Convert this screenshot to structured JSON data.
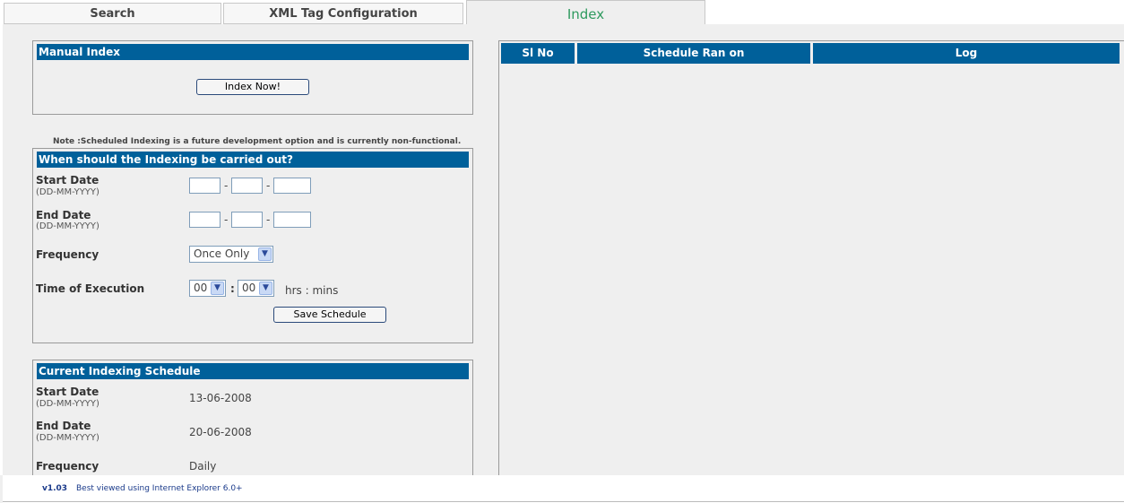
{
  "tabs": [
    {
      "label": "Search"
    },
    {
      "label": "XML Tag Configuration"
    },
    {
      "label": "Index"
    }
  ],
  "manual_index": {
    "title": "Manual Index",
    "button": "Index Now!"
  },
  "note": "Note :Scheduled Indexing is a future development option and is currently non-functional.",
  "schedule_form": {
    "title": "When should the Indexing be carried out?",
    "start_date_label": "Start Date",
    "start_date_hint": "(DD-MM-YYYY)",
    "end_date_label": "End Date",
    "end_date_hint": "(DD-MM-YYYY)",
    "frequency_label": "Frequency",
    "frequency_value": "Once Only",
    "time_label": "Time of Execution",
    "hours_value": "00",
    "minutes_value": "00",
    "time_separator": ":",
    "date_separator": "-",
    "time_unit": "hrs : mins",
    "save_button": "Save Schedule"
  },
  "current_schedule": {
    "title": "Current Indexing Schedule",
    "start_date_label": "Start Date",
    "start_date_hint": "(DD-MM-YYYY)",
    "start_date_value": "13-06-2008",
    "end_date_label": "End Date",
    "end_date_hint": "(DD-MM-YYYY)",
    "end_date_value": "20-06-2008",
    "frequency_label": "Frequency",
    "frequency_value": "Daily"
  },
  "log_table": {
    "columns": [
      "Sl No",
      "Schedule Ran on",
      "Log"
    ],
    "rows": []
  },
  "footer": {
    "version": "v1.03",
    "hint": "Best viewed using Internet Explorer 6.0+"
  },
  "colors": {
    "header_blue": "#00609a",
    "active_tab_green": "#2e9a5e",
    "panel_bg": "#efefef"
  }
}
